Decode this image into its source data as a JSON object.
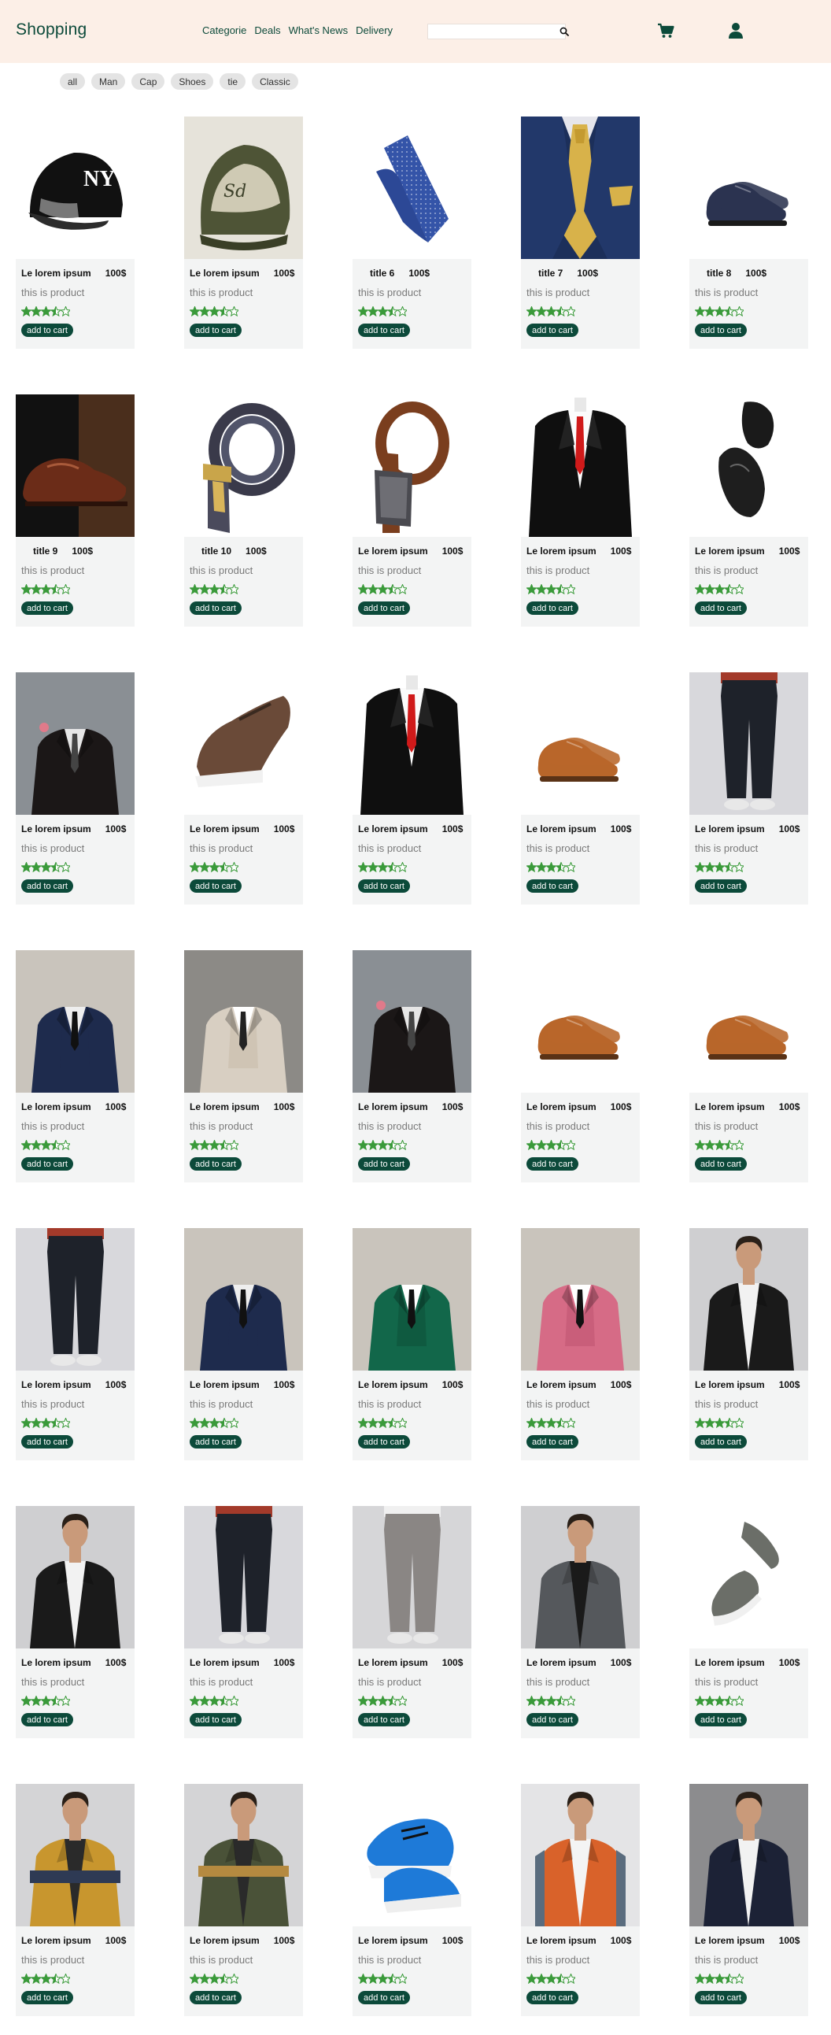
{
  "header": {
    "logo": "Shopping",
    "nav": [
      "Categorie",
      "Deals",
      "What's News",
      "Delivery"
    ],
    "search": {
      "value": "",
      "placeholder": ""
    },
    "icons": {
      "search": "search-icon",
      "cart": "cart-icon",
      "user": "user-icon"
    }
  },
  "filters": [
    "all",
    "Man",
    "Cap",
    "Shoes",
    "tie",
    "Classic"
  ],
  "theme": {
    "accent": "#0c4a3a",
    "header_bg": "#fcefe7",
    "star": "#3a9a3a",
    "card_bg": "#f3f4f4"
  },
  "rating": 3.5,
  "products": [
    {
      "title": "Le lorem ipsum",
      "price": "100$",
      "desc": "this is product",
      "button": "add to cart",
      "image": "black-cap"
    },
    {
      "title": "Le lorem ipsum",
      "price": "100$",
      "desc": "this is product",
      "button": "add to cart",
      "image": "olive-cap"
    },
    {
      "title": "title 6",
      "price": "100$",
      "desc": "this is product",
      "button": "add to cart",
      "image": "blue-tie"
    },
    {
      "title": "title 7",
      "price": "100$",
      "desc": "this is product",
      "button": "add to cart",
      "image": "gold-tie-suit"
    },
    {
      "title": "title 8",
      "price": "100$",
      "desc": "this is product",
      "button": "add to cart",
      "image": "navy-shoes"
    },
    {
      "title": "title 9",
      "price": "100$",
      "desc": "this is product",
      "button": "add to cart",
      "image": "brown-shoe-dark"
    },
    {
      "title": "title 10",
      "price": "100$",
      "desc": "this is product",
      "button": "add to cart",
      "image": "belt-coiled"
    },
    {
      "title": "Le lorem ipsum",
      "price": "100$",
      "desc": "this is product",
      "button": "add to cart",
      "image": "brown-belt"
    },
    {
      "title": "Le lorem ipsum",
      "price": "100$",
      "desc": "this is product",
      "button": "add to cart",
      "image": "black-suit-red-tie"
    },
    {
      "title": "Le lorem ipsum",
      "price": "100$",
      "desc": "this is product",
      "button": "add to cart",
      "image": "black-loafers"
    },
    {
      "title": "Le lorem ipsum",
      "price": "100$",
      "desc": "this is product",
      "button": "add to cart",
      "image": "man-dark-suit"
    },
    {
      "title": "Le lorem ipsum",
      "price": "100$",
      "desc": "this is product",
      "button": "add to cart",
      "image": "brown-sneaker"
    },
    {
      "title": "Le lorem ipsum",
      "price": "100$",
      "desc": "this is product",
      "button": "add to cart",
      "image": "black-suit-red-tie"
    },
    {
      "title": "Le lorem ipsum",
      "price": "100$",
      "desc": "this is product",
      "button": "add to cart",
      "image": "tan-brogues"
    },
    {
      "title": "Le lorem ipsum",
      "price": "100$",
      "desc": "this is product",
      "button": "add to cart",
      "image": "black-trousers"
    },
    {
      "title": "Le lorem ipsum",
      "price": "100$",
      "desc": "this is product",
      "button": "add to cart",
      "image": "navy-3piece"
    },
    {
      "title": "Le lorem ipsum",
      "price": "100$",
      "desc": "this is product",
      "button": "add to cart",
      "image": "beige-3piece"
    },
    {
      "title": "Le lorem ipsum",
      "price": "100$",
      "desc": "this is product",
      "button": "add to cart",
      "image": "man-dark-suit"
    },
    {
      "title": "Le lorem ipsum",
      "price": "100$",
      "desc": "this is product",
      "button": "add to cart",
      "image": "tan-brogues"
    },
    {
      "title": "Le lorem ipsum",
      "price": "100$",
      "desc": "this is product",
      "button": "add to cart",
      "image": "tan-brogues"
    },
    {
      "title": "Le lorem ipsum",
      "price": "100$",
      "desc": "this is product",
      "button": "add to cart",
      "image": "black-trousers"
    },
    {
      "title": "Le lorem ipsum",
      "price": "100$",
      "desc": "this is product",
      "button": "add to cart",
      "image": "navy-3piece"
    },
    {
      "title": "Le lorem ipsum",
      "price": "100$",
      "desc": "this is product",
      "button": "add to cart",
      "image": "green-3piece"
    },
    {
      "title": "Le lorem ipsum",
      "price": "100$",
      "desc": "this is product",
      "button": "add to cart",
      "image": "pink-3piece"
    },
    {
      "title": "Le lorem ipsum",
      "price": "100$",
      "desc": "this is product",
      "button": "add to cart",
      "image": "black-denim-jacket"
    },
    {
      "title": "Le lorem ipsum",
      "price": "100$",
      "desc": "this is product",
      "button": "add to cart",
      "image": "black-denim-jacket"
    },
    {
      "title": "Le lorem ipsum",
      "price": "100$",
      "desc": "this is product",
      "button": "add to cart",
      "image": "black-trousers"
    },
    {
      "title": "Le lorem ipsum",
      "price": "100$",
      "desc": "this is product",
      "button": "add to cart",
      "image": "grey-trousers"
    },
    {
      "title": "Le lorem ipsum",
      "price": "100$",
      "desc": "this is product",
      "button": "add to cart",
      "image": "grey-denim-jacket"
    },
    {
      "title": "Le lorem ipsum",
      "price": "100$",
      "desc": "this is product",
      "button": "add to cart",
      "image": "grey-sneakers"
    },
    {
      "title": "Le lorem ipsum",
      "price": "100$",
      "desc": "this is product",
      "button": "add to cart",
      "image": "mustard-jacket"
    },
    {
      "title": "Le lorem ipsum",
      "price": "100$",
      "desc": "this is product",
      "button": "add to cart",
      "image": "olive-jacket"
    },
    {
      "title": "Le lorem ipsum",
      "price": "100$",
      "desc": "this is product",
      "button": "add to cart",
      "image": "blue-sneakers"
    },
    {
      "title": "Le lorem ipsum",
      "price": "100$",
      "desc": "this is product",
      "button": "add to cart",
      "image": "orange-vest"
    },
    {
      "title": "Le lorem ipsum",
      "price": "100$",
      "desc": "this is product",
      "button": "add to cart",
      "image": "navy-denim-jacket"
    }
  ]
}
